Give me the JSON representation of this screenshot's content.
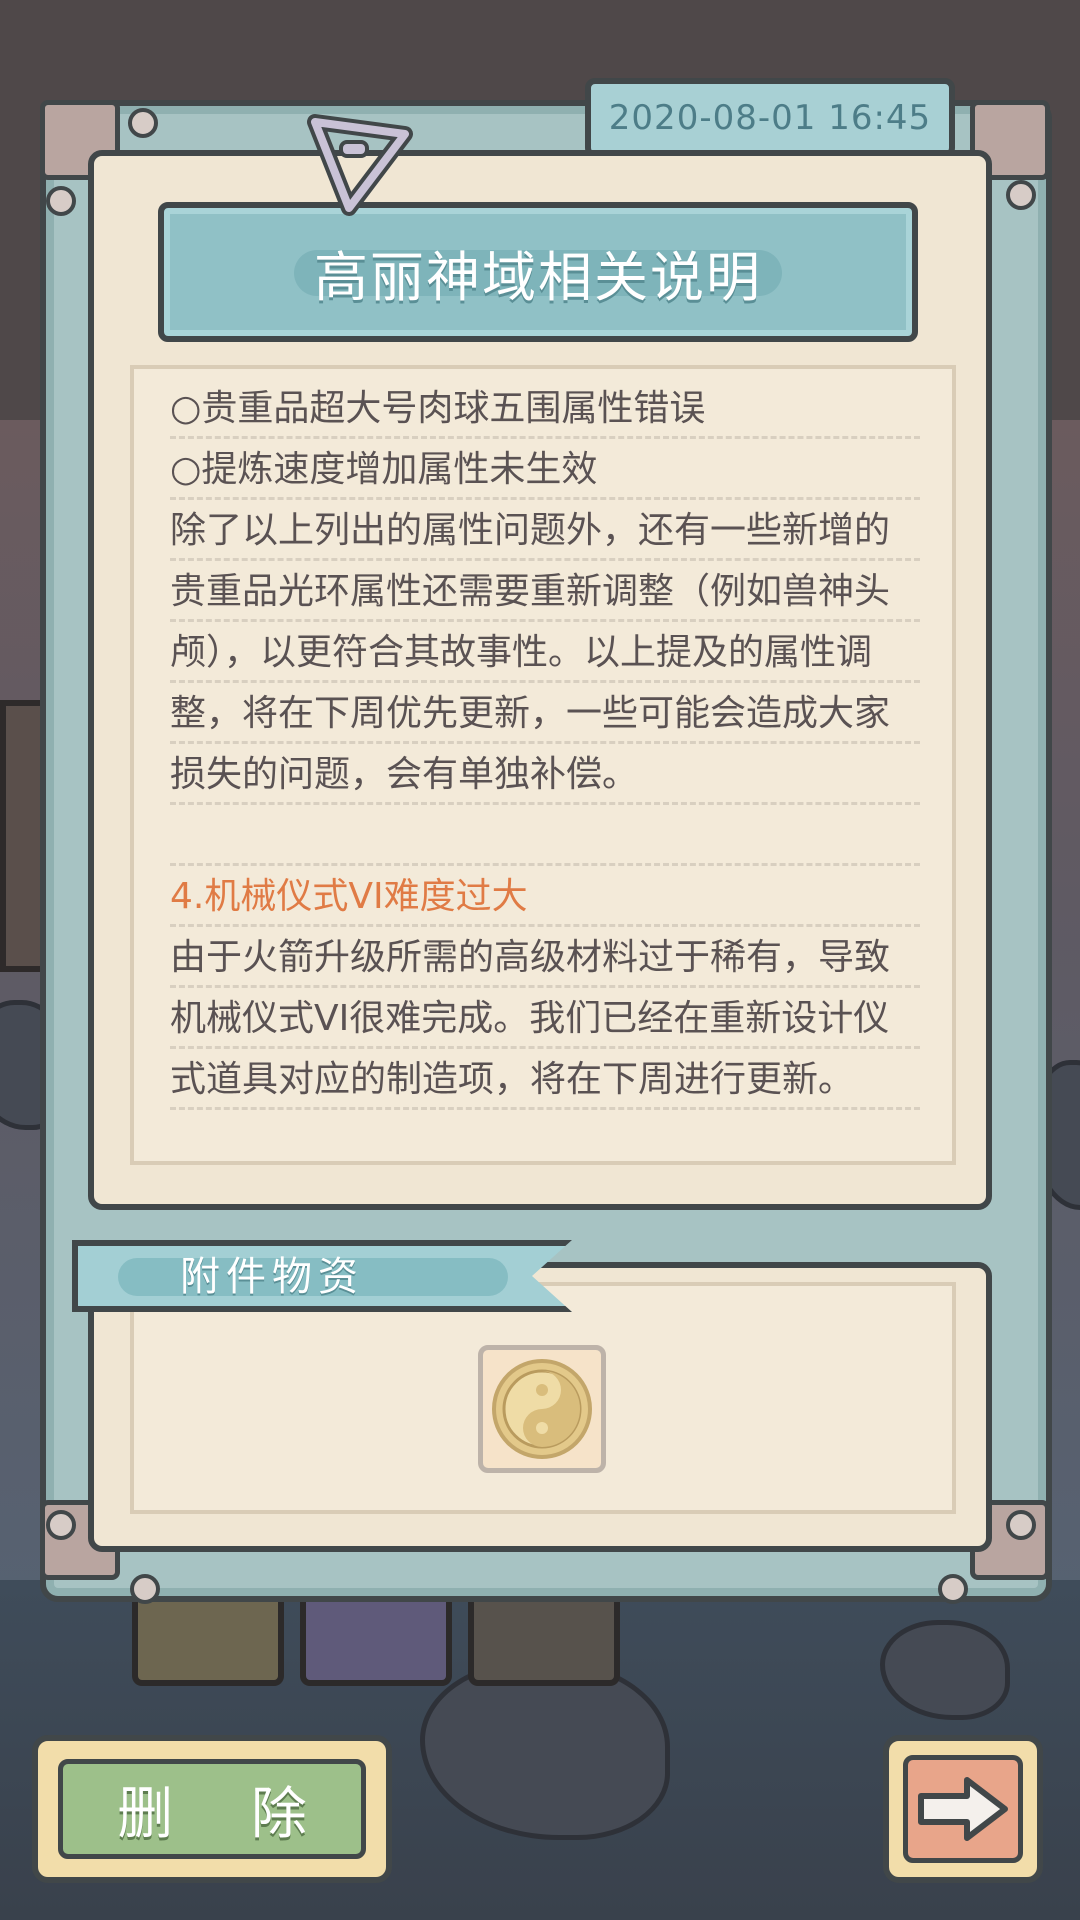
{
  "header": {
    "date": "2020-08-01  16:45",
    "title": "高丽神域相关说明"
  },
  "content": {
    "lines": [
      {
        "text": "○贵重品超大号肉球五围属性错误",
        "style": "normal"
      },
      {
        "text": "○提炼速度增加属性未生效",
        "style": "normal"
      },
      {
        "text": "除了以上列出的属性问题外，还有一些新增的",
        "style": "normal"
      },
      {
        "text": "贵重品光环属性还需要重新调整（例如兽神头",
        "style": "normal"
      },
      {
        "text": "颅），以更符合其故事性。以上提及的属性调",
        "style": "normal"
      },
      {
        "text": "整，将在下周优先更新，一些可能会造成大家",
        "style": "normal"
      },
      {
        "text": "损失的问题，会有单独补偿。",
        "style": "normal"
      },
      {
        "text": "",
        "style": "blank"
      },
      {
        "text": "4.机械仪式VI难度过大",
        "style": "heading"
      },
      {
        "text": "由于火箭升级所需的高级材料过于稀有，导致",
        "style": "normal"
      },
      {
        "text": "机械仪式VI很难完成。我们已经在重新设计仪",
        "style": "normal"
      },
      {
        "text": "式道具对应的制造项，将在下周进行更新。",
        "style": "normal"
      }
    ]
  },
  "attachment": {
    "label": "附件物资",
    "items": [
      {
        "icon": "yin-yang-coin-icon"
      }
    ]
  },
  "buttons": {
    "delete_label": "删 除",
    "next_icon": "arrow-right-icon"
  },
  "colors": {
    "heading": "#e07b45",
    "body_text": "#5a5253",
    "frame": "#a7c3c3",
    "paper": "#f0e6d3",
    "delete_button": "#9dc08a",
    "next_button": "#e8a58a"
  }
}
